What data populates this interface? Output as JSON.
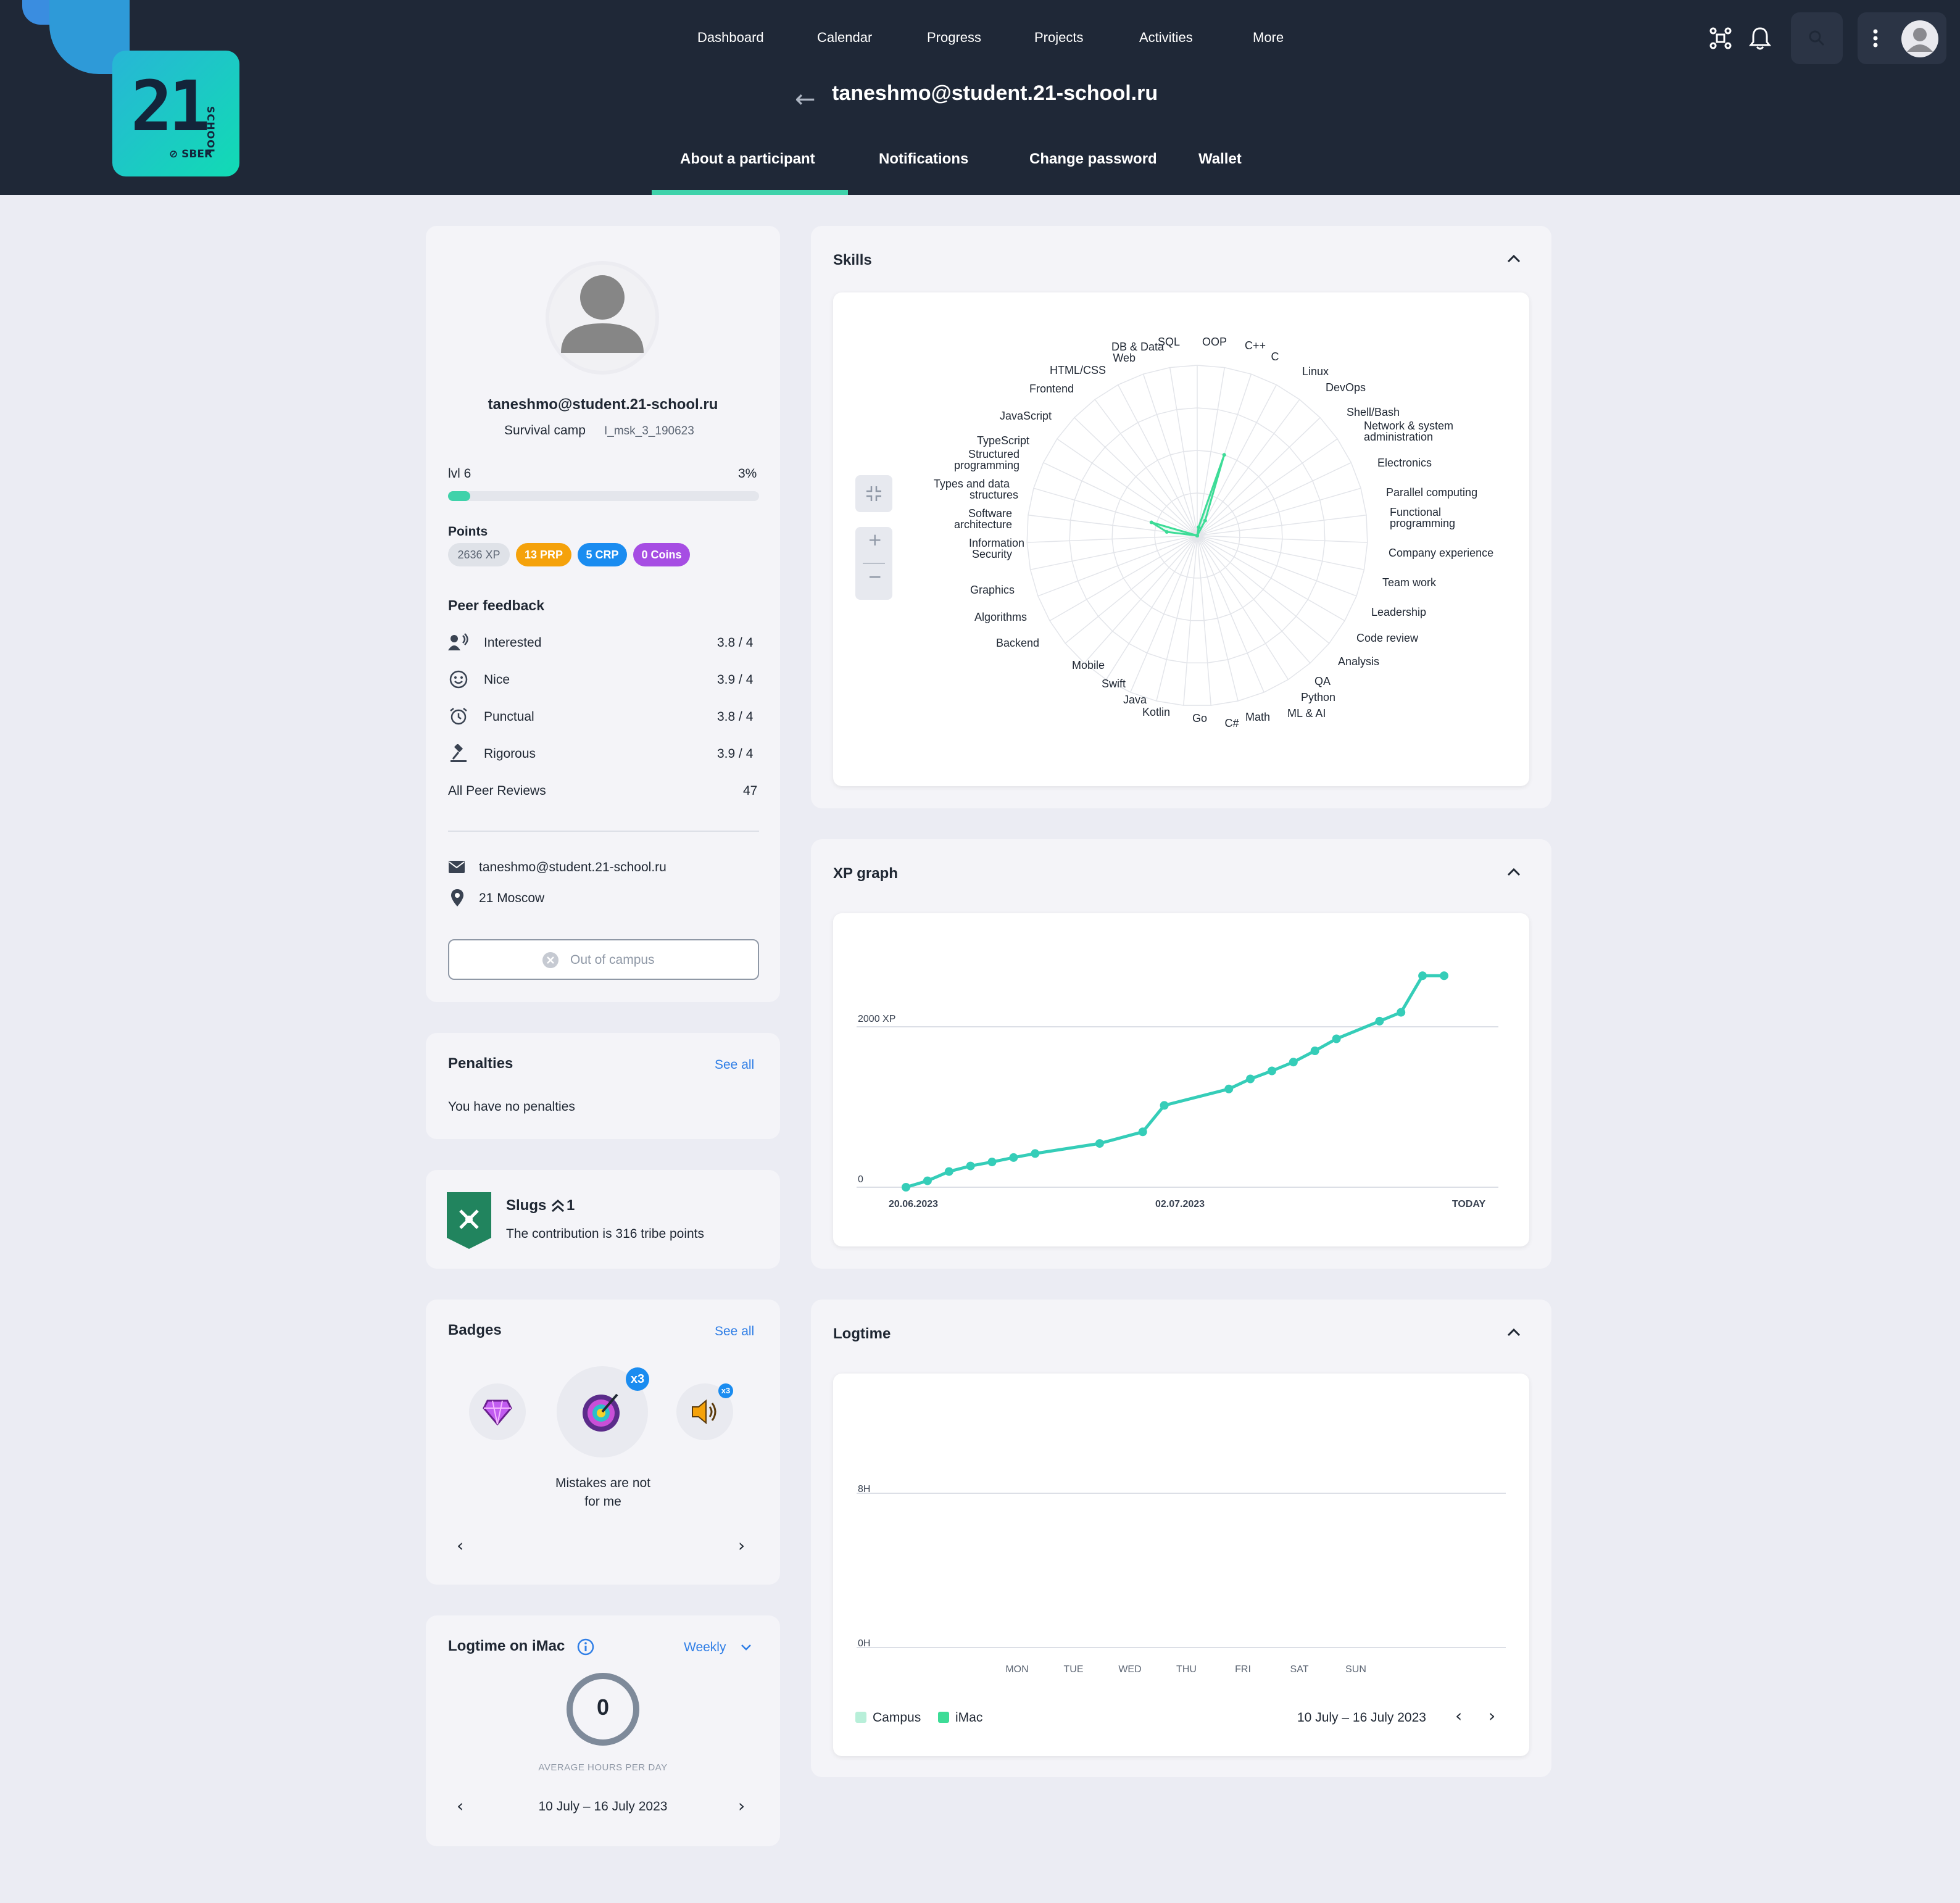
{
  "header": {
    "nav": [
      "Dashboard",
      "Calendar",
      "Progress",
      "Projects",
      "Activities",
      "More"
    ],
    "page_title": "taneshmo@student.21-school.ru",
    "subtabs": [
      "About a participant",
      "Notifications",
      "Change password",
      "Wallet"
    ],
    "logo": {
      "number": "21",
      "school": "SCHOOL",
      "brand": "SBER"
    }
  },
  "profile": {
    "email": "taneshmo@student.21-school.ru",
    "wave": "Survival camp",
    "wave_code": "I_msk_3_190623",
    "level": "lvl 6",
    "level_progress": "3%",
    "level_progress_value": 0.03,
    "points_label": "Points",
    "xp": "2636 XP",
    "prp": "13 PRP",
    "crp": "5 CRP",
    "coins": "0 Coins",
    "peer_feedback_title": "Peer feedback",
    "feedback": [
      {
        "label": "Interested",
        "value": "3.8 / 4",
        "icon": "people-speaking-icon"
      },
      {
        "label": "Nice",
        "value": "3.9 / 4",
        "icon": "smile-icon"
      },
      {
        "label": "Punctual",
        "value": "3.8 / 4",
        "icon": "alarm-clock-icon"
      },
      {
        "label": "Rigorous",
        "value": "3.9 / 4",
        "icon": "gavel-icon"
      }
    ],
    "all_reviews_label": "All Peer Reviews",
    "all_reviews_value": "47",
    "contact_email": "taneshmo@student.21-school.ru",
    "campus": "21 Moscow",
    "status_button": "Out of campus"
  },
  "penalties": {
    "title": "Penalties",
    "see_all": "See all",
    "text": "You have no penalties"
  },
  "tribe": {
    "name": "Slugs",
    "rank": "1",
    "text": "The contribution is 316 tribe points"
  },
  "badges": {
    "title": "Badges",
    "see_all": "See all",
    "caption_line1": "Mistakes are not",
    "caption_line2": "for me",
    "count_main": "x3",
    "count_right": "x3"
  },
  "logtime_imac": {
    "title": "Logtime on iMac",
    "period": "Weekly",
    "value": "0",
    "caption": "AVERAGE HOURS PER DAY",
    "range": "10 July – 16 July 2023"
  },
  "skills": {
    "title": "Skills",
    "labels": [
      "SQL",
      "OOP",
      "C++",
      "C",
      "Linux",
      "DevOps",
      "Shell/Bash",
      "Network & system",
      "administration",
      "Electronics",
      "Parallel computing",
      "Functional",
      "programming",
      "Company experience",
      "Team work",
      "Leadership",
      "Code review",
      "Analysis",
      "QA",
      "Python",
      "ML & AI",
      "Math",
      "C#",
      "Go",
      "Kotlin",
      "Java",
      "Swift",
      "Mobile",
      "Backend",
      "Algorithms",
      "Graphics",
      "Information",
      "Security",
      "Software",
      "architecture",
      "Types and data",
      "structures",
      "Structured",
      "programming",
      "TypeScript",
      "JavaScript",
      "Frontend",
      "HTML/CSS",
      "Web",
      "DB & Data"
    ]
  },
  "xp_graph": {
    "title": "XP graph"
  },
  "logtime": {
    "title": "Logtime",
    "legend_campus": "Campus",
    "legend_imac": "iMac",
    "range": "10 July – 16 July 2023"
  },
  "chart_data": [
    {
      "type": "radar",
      "title": "Skills",
      "categories": [
        "SQL",
        "OOP",
        "C++",
        "C",
        "Linux",
        "DevOps",
        "Shell/Bash",
        "Network & system administration",
        "Electronics",
        "Parallel computing",
        "Functional programming",
        "Company experience",
        "Team work",
        "Leadership",
        "Code review",
        "Analysis",
        "QA",
        "Python",
        "ML & AI",
        "Math",
        "C#",
        "Go",
        "Kotlin",
        "Java",
        "Swift",
        "Mobile",
        "Backend",
        "Algorithms",
        "Graphics",
        "Information Security",
        "Software architecture",
        "Types and data structures",
        "Structured programming",
        "TypeScript",
        "JavaScript",
        "Frontend",
        "HTML/CSS",
        "Web",
        "DB & Data"
      ],
      "values": [
        0,
        5,
        50,
        10,
        0,
        0,
        0,
        0,
        0,
        0,
        0,
        0,
        0,
        0,
        0,
        0,
        0,
        0,
        0,
        0,
        0,
        0,
        0,
        0,
        0,
        0,
        0,
        0,
        0,
        0,
        18,
        28,
        0,
        0,
        0,
        0,
        0,
        0,
        0
      ],
      "rmax": 100
    },
    {
      "type": "line",
      "title": "XP graph",
      "x": [
        "20.06.2023",
        "21.06.2023",
        "22.06.2023",
        "23.06.2023",
        "24.06.2023",
        "25.06.2023",
        "26.06.2023",
        "29.06.2023",
        "01.07.2023",
        "02.07.2023",
        "05.07.2023",
        "06.07.2023",
        "07.07.2023",
        "08.07.2023",
        "09.07.2023",
        "10.07.2023",
        "12.07.2023",
        "13.07.2023",
        "14.07.2023",
        "15.07.2023"
      ],
      "y": [
        0,
        80,
        195,
        265,
        315,
        370,
        420,
        545,
        690,
        1020,
        1225,
        1350,
        1450,
        1560,
        1700,
        1850,
        2070,
        2180,
        2636,
        2636
      ],
      "ytick_labels": [
        "0",
        "2000 XP"
      ],
      "ylim": [
        0,
        2800
      ],
      "xtick_labels": [
        "20.06.2023",
        "02.07.2023",
        "TODAY"
      ]
    },
    {
      "type": "bar",
      "title": "Logtime",
      "categories": [
        "MON",
        "TUE",
        "WED",
        "THU",
        "FRI",
        "SAT",
        "SUN"
      ],
      "series": [
        {
          "name": "Campus",
          "values": [
            0,
            0,
            0,
            0,
            0,
            0,
            0
          ]
        },
        {
          "name": "iMac",
          "values": [
            0,
            0,
            0,
            0,
            0,
            0,
            0
          ]
        }
      ],
      "ytick_labels": [
        "0H",
        "8H"
      ],
      "colors": {
        "Campus": "#b8efd9",
        "iMac": "#3ddc97"
      }
    }
  ],
  "colors": {
    "accent": "#3fd2aa",
    "header_bg": "#1f2837",
    "link": "#2f7ee6",
    "prp": "#f5a20b",
    "crp": "#1a8cf0",
    "coins": "#a64de3"
  }
}
